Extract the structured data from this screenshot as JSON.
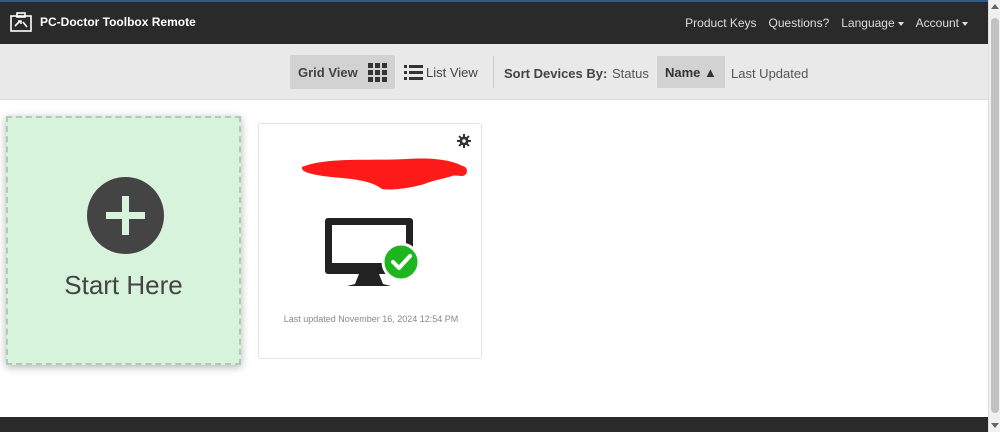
{
  "header": {
    "brand_title": "PC-Doctor Toolbox Remote",
    "brand_icon": "toolbox-icon",
    "nav": {
      "product_keys": "Product Keys",
      "questions": "Questions?",
      "language": "Language",
      "account": "Account"
    }
  },
  "toolbar": {
    "grid_view_label": "Grid View",
    "list_view_label": "List View",
    "sort_by_label": "Sort Devices By:",
    "sort_options": {
      "status": "Status",
      "name": "Name ▲",
      "last_updated": "Last Updated"
    },
    "active_view": "grid",
    "active_sort": "name"
  },
  "start_card": {
    "label": "Start Here",
    "icon": "plus-circle-icon"
  },
  "device_card": {
    "name_redacted": true,
    "status_icon": "check-circle-icon",
    "last_updated": "Last updated November 16, 2024 12:54 PM"
  },
  "colors": {
    "topbar_bg": "#2a2a2a",
    "start_card_bg": "#d8f3dc",
    "status_green": "#1fb51f",
    "redaction_red": "#ff1a1a"
  }
}
